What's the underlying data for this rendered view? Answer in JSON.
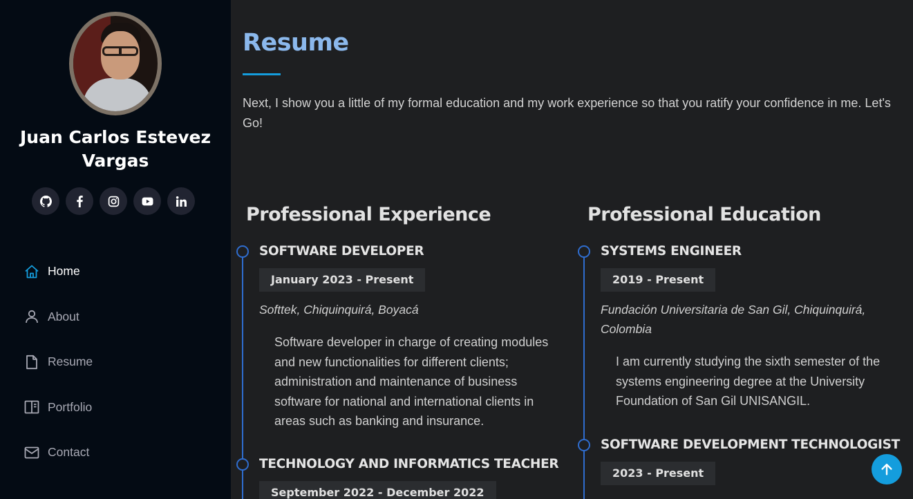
{
  "profile": {
    "name_line1": "Juan Carlos Estevez",
    "name_line2": "Vargas"
  },
  "social": [
    {
      "icon": "github-icon"
    },
    {
      "icon": "facebook-icon"
    },
    {
      "icon": "instagram-icon"
    },
    {
      "icon": "youtube-icon"
    },
    {
      "icon": "linkedin-icon"
    }
  ],
  "nav": {
    "items": [
      {
        "label": "Home",
        "icon": "home-icon",
        "active": true
      },
      {
        "label": "About",
        "icon": "person-icon"
      },
      {
        "label": "Resume",
        "icon": "file-icon"
      },
      {
        "label": "Portfolio",
        "icon": "book-icon"
      },
      {
        "label": "Contact",
        "icon": "envelope-icon"
      }
    ]
  },
  "resume": {
    "title": "Resume",
    "intro": "Next, I show you a little of my formal education and my work experience so that you ratify your confidence in me. Let's Go!",
    "experience": {
      "heading": "Professional Experience",
      "entries": [
        {
          "title": "SOFTWARE DEVELOPER",
          "date": "January 2023 - Present",
          "place": "Softtek, Chiquinquirá, Boyacá",
          "description": "Software developer in charge of creating modules and new functionalities for different clients; administration and maintenance of business software for national and international clients in areas such as banking and insurance."
        },
        {
          "title": "TECHNOLOGY AND INFORMATICS TEACHER",
          "date": "September 2022 - December 2022"
        }
      ]
    },
    "education": {
      "heading": "Professional Education",
      "entries": [
        {
          "title": "SYSTEMS ENGINEER",
          "date": "2019 - Present",
          "place": "Fundación Universitaria de San Gil, Chiquinquirá, Colombia",
          "description": "I am currently studying the sixth semester of the systems engineering degree at the University Foundation of San Gil UNISANGIL."
        },
        {
          "title": "SOFTWARE DEVELOPMENT TECHNOLOGIST",
          "date": "2023 - Present"
        }
      ]
    }
  },
  "colors": {
    "accent": "#149ddd",
    "title": "#8bb8ec",
    "timeline": "#2f6dcf",
    "sidebar_bg": "#040b14",
    "main_bg": "#1e1f21"
  }
}
